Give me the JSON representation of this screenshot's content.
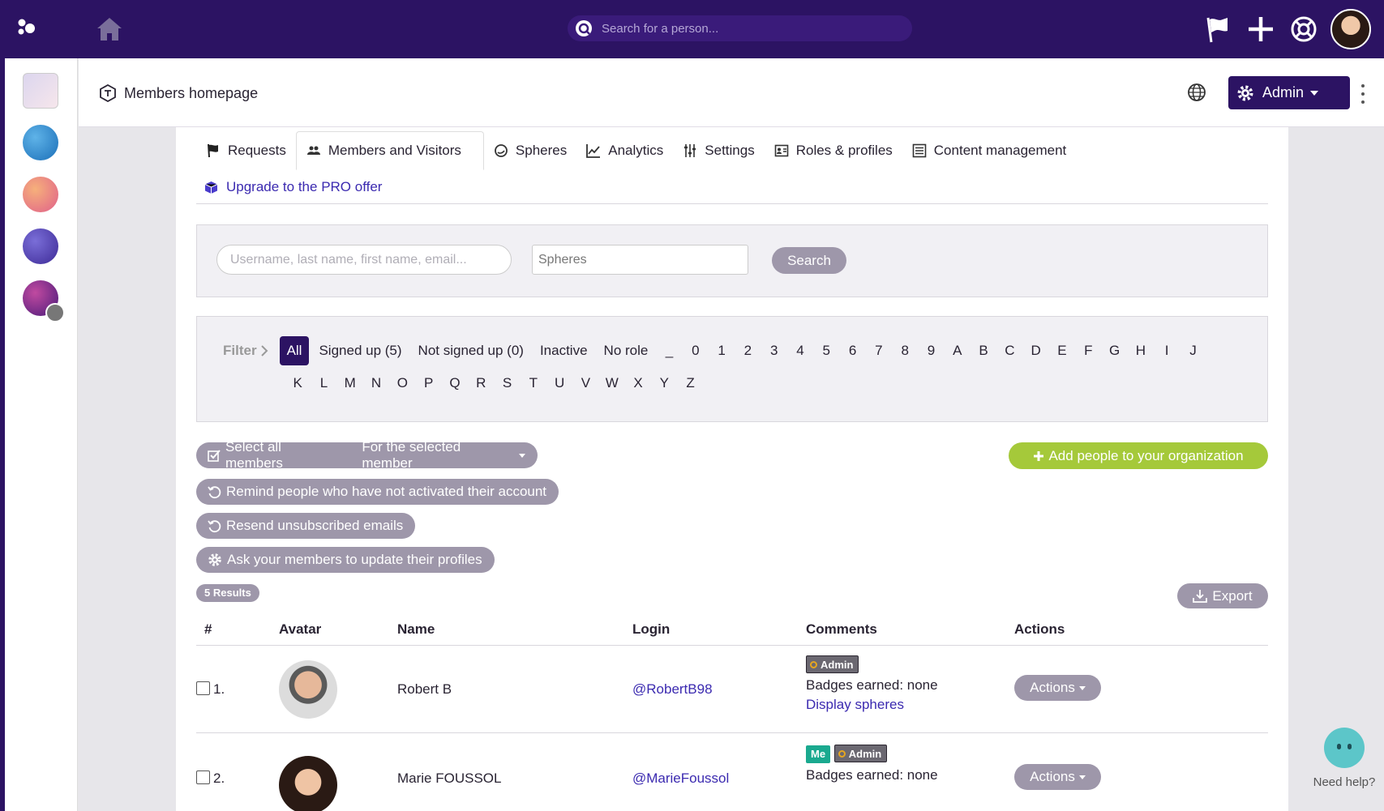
{
  "topbar": {
    "search_placeholder": "Search for a person...",
    "icons": [
      "app-logo-icon",
      "home-icon",
      "search-icon",
      "flag-icon",
      "plus-icon",
      "help-lifebuoy-icon",
      "user-avatar"
    ]
  },
  "header": {
    "title": "Members homepage",
    "admin_label": "Admin"
  },
  "tabs": [
    {
      "label": "Requests",
      "icon": "flag-icon"
    },
    {
      "label": "Members and Visitors",
      "icon": "users-icon"
    },
    {
      "label": "Spheres",
      "icon": "sphere-icon"
    },
    {
      "label": "Analytics",
      "icon": "chart-icon"
    },
    {
      "label": "Settings",
      "icon": "sliders-icon"
    },
    {
      "label": "Roles & profiles",
      "icon": "id-card-icon"
    },
    {
      "label": "Content management",
      "icon": "list-icon"
    }
  ],
  "upgrade": {
    "label": "Upgrade to the PRO offer"
  },
  "search_panel": {
    "name_placeholder": "Username, last name, first name, email...",
    "spheres_placeholder": "Spheres",
    "search_label": "Search"
  },
  "filter": {
    "label": "Filter",
    "options": [
      "All",
      "Signed up (5)",
      "Not signed up (0)",
      "Inactive",
      "No role"
    ],
    "letters_row1": [
      "_",
      "0",
      "1",
      "2",
      "3",
      "4",
      "5",
      "6",
      "7",
      "8",
      "9",
      "A",
      "B",
      "C",
      "D",
      "E",
      "F",
      "G",
      "H",
      "I",
      "J"
    ],
    "letters_row2": [
      "K",
      "L",
      "M",
      "N",
      "O",
      "P",
      "Q",
      "R",
      "S",
      "T",
      "U",
      "V",
      "W",
      "X",
      "Y",
      "Z"
    ]
  },
  "bulk": {
    "select_all": "Select all members",
    "for_selected": "For the selected member",
    "add_people": "Add people to your organization",
    "remind": "Remind people who have not activated their account",
    "resend": "Resend unsubscribed emails",
    "ask_update": "Ask your members to update their profiles"
  },
  "results": {
    "count_label": "5 Results",
    "export_label": "Export"
  },
  "table": {
    "columns": [
      "#",
      "Avatar",
      "Name",
      "Login",
      "Comments",
      "Actions"
    ],
    "rows": [
      {
        "index": "1.",
        "name": "Robert B",
        "login": "@RobertB98",
        "me": "",
        "admin": "Admin",
        "badges": "Badges earned: none",
        "spheres_link": "Display spheres",
        "action": "Actions"
      },
      {
        "index": "2.",
        "name": "Marie FOUSSOL",
        "login": "@MarieFoussol",
        "me": "Me",
        "admin": "Admin",
        "badges": "Badges earned: none",
        "spheres_link": "",
        "action": "Actions"
      }
    ]
  },
  "help": {
    "label": "Need help?"
  },
  "colors": {
    "brand": "#2c1363",
    "accent_green": "#a5c93a",
    "pill_gray": "#9e97aa",
    "link": "#3b2ab0",
    "me_badge": "#1aa98f"
  }
}
